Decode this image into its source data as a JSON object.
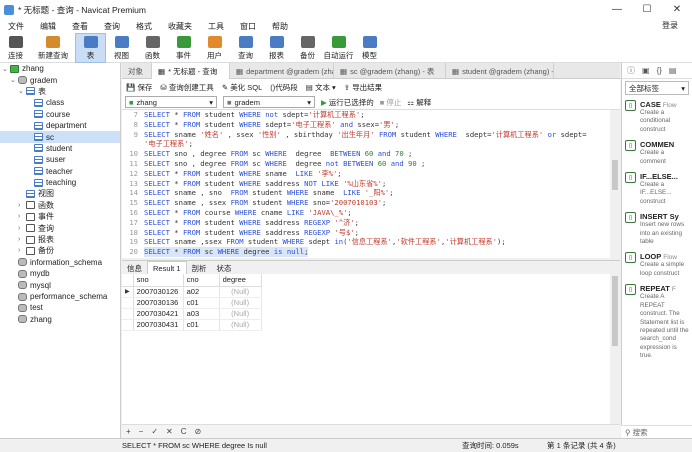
{
  "window": {
    "title": "* 无标题 - 查询 - Navicat Premium"
  },
  "menu": [
    "文件",
    "编辑",
    "查看",
    "查询",
    "格式",
    "收藏夹",
    "工具",
    "窗口",
    "帮助"
  ],
  "login_label": "登录",
  "toolbar": [
    {
      "label": "连接",
      "icon": "plug-icon",
      "color": "#555"
    },
    {
      "label": "新建查询",
      "icon": "new-query-icon",
      "color": "#d48b2c"
    },
    {
      "label": "表",
      "icon": "table-icon",
      "color": "#4a7cc4",
      "active": true
    },
    {
      "label": "视图",
      "icon": "view-icon",
      "color": "#4a7cc4"
    },
    {
      "label": "函数",
      "icon": "function-icon",
      "color": "#666"
    },
    {
      "label": "事件",
      "icon": "event-icon",
      "color": "#3a9a3a"
    },
    {
      "label": "用户",
      "icon": "user-icon",
      "color": "#e08a2c"
    },
    {
      "label": "查询",
      "icon": "query-icon",
      "color": "#4a7cc4"
    },
    {
      "label": "报表",
      "icon": "report-icon",
      "color": "#4a7cc4"
    },
    {
      "label": "备份",
      "icon": "backup-icon",
      "color": "#666"
    },
    {
      "label": "自动运行",
      "icon": "autorun-icon",
      "color": "#3a9a3a"
    },
    {
      "label": "模型",
      "icon": "model-icon",
      "color": "#4a7cc4"
    }
  ],
  "tree": [
    {
      "label": "zhang",
      "indent": 0,
      "type": "conn",
      "arrow": "v"
    },
    {
      "label": "gradem",
      "indent": 1,
      "type": "db",
      "arrow": "v"
    },
    {
      "label": "表",
      "indent": 2,
      "type": "tbl",
      "arrow": "v"
    },
    {
      "label": "class",
      "indent": 3,
      "type": "tbl",
      "arrow": ""
    },
    {
      "label": "course",
      "indent": 3,
      "type": "tbl",
      "arrow": ""
    },
    {
      "label": "department",
      "indent": 3,
      "type": "tbl",
      "arrow": ""
    },
    {
      "label": "sc",
      "indent": 3,
      "type": "tbl",
      "arrow": "",
      "selected": true
    },
    {
      "label": "student",
      "indent": 3,
      "type": "tbl",
      "arrow": ""
    },
    {
      "label": "suser",
      "indent": 3,
      "type": "tbl",
      "arrow": ""
    },
    {
      "label": "teacher",
      "indent": 3,
      "type": "tbl",
      "arrow": ""
    },
    {
      "label": "teaching",
      "indent": 3,
      "type": "tbl",
      "arrow": ""
    },
    {
      "label": "视图",
      "indent": 2,
      "type": "tbl",
      "arrow": ""
    },
    {
      "label": "函数",
      "indent": 2,
      "type": "fn",
      "arrow": ">"
    },
    {
      "label": "事件",
      "indent": 2,
      "type": "fn",
      "arrow": ">"
    },
    {
      "label": "查询",
      "indent": 2,
      "type": "fn",
      "arrow": ">"
    },
    {
      "label": "报表",
      "indent": 2,
      "type": "fn",
      "arrow": ">"
    },
    {
      "label": "备份",
      "indent": 2,
      "type": "fn",
      "arrow": ">"
    },
    {
      "label": "information_schema",
      "indent": 1,
      "type": "db",
      "arrow": ""
    },
    {
      "label": "mydb",
      "indent": 1,
      "type": "db",
      "arrow": ""
    },
    {
      "label": "mysql",
      "indent": 1,
      "type": "db",
      "arrow": ""
    },
    {
      "label": "performance_schema",
      "indent": 1,
      "type": "db",
      "arrow": ""
    },
    {
      "label": "test",
      "indent": 1,
      "type": "db",
      "arrow": ""
    },
    {
      "label": "zhang",
      "indent": 1,
      "type": "db",
      "arrow": ""
    }
  ],
  "tabs": [
    {
      "label": "对象",
      "active": false
    },
    {
      "label": "* 无标题 - 查询",
      "active": true
    },
    {
      "label": "department @gradem (zha...",
      "active": false
    },
    {
      "label": "sc @gradem (zhang) - 表",
      "active": false
    },
    {
      "label": "student @gradem (zhang) - ...",
      "active": false
    }
  ],
  "query_toolbar": {
    "save": "保存",
    "builder": "查询创建工具",
    "beautify": "美化 SQL",
    "snippet": "()代码段",
    "text": "文本",
    "export": "导出结果"
  },
  "query_toolbar2": {
    "connection": "zhang",
    "database": "gradem",
    "run": "运行已选择的",
    "stop": "停止",
    "explain": "解释"
  },
  "editor_lines": [
    {
      "no": "7",
      "code": "SELECT * FROM student WHERE not sdept='计算机工程系';"
    },
    {
      "no": "8",
      "code": "SELECT * FROM student WHERE sdept='电子工程系' and ssex='男';"
    },
    {
      "no": "9",
      "code": "SELECT sname '姓名' , ssex '性别' , sbirthday '出生年月' FROM student WHERE  sdept='计算机工程系' or sdept="
    },
    {
      "no": "",
      "code": "'电子工程系';"
    },
    {
      "no": "10",
      "code": "SELECT sno , degree FROM sc WHERE  degree  BETWEEN 60 and 70 ;"
    },
    {
      "no": "11",
      "code": "SELECT sno , degree FROM sc WHERE  degree not BETWEEN 60 and 90 ;"
    },
    {
      "no": "12",
      "code": "SELECT * FROM student WHERE sname  LIKE '李%';"
    },
    {
      "no": "13",
      "code": "SELECT * FROM student WHERE saddress NOT LIKE '%山东省%';"
    },
    {
      "no": "14",
      "code": "SELECT sname , sno  FROM student WHERE sname  LIKE '_阳%';"
    },
    {
      "no": "15",
      "code": "SELECT sname , ssex FROM student WHERE sno='2007010103';"
    },
    {
      "no": "16",
      "code": "SELECT * FROM course WHERE cname LIKE 'JAVA\\_%';"
    },
    {
      "no": "17",
      "code": "SELECT * FROM student WHERE saddress REGEXP '^济';"
    },
    {
      "no": "18",
      "code": "SELECT * FROM student WHERE saddress REGEXP '号$';"
    },
    {
      "no": "19",
      "code": "SELECT sname ,ssex FROM student WHERE sdept in('信息工程系','软件工程系','计算机工程系');"
    },
    {
      "no": "20",
      "code": "SELECT * FROM sc WHERE degree is null;",
      "highlight": true
    }
  ],
  "result_tabs": [
    {
      "label": "信息",
      "active": false
    },
    {
      "label": "Result 1",
      "active": true
    },
    {
      "label": "剖析",
      "active": false
    },
    {
      "label": "状态",
      "active": false
    }
  ],
  "grid": {
    "columns": [
      "sno",
      "cno",
      "degree"
    ],
    "rows": [
      [
        "2007030126",
        "a02",
        "(Null)"
      ],
      [
        "2007030136",
        "c01",
        "(Null)"
      ],
      [
        "2007030421",
        "a03",
        "(Null)"
      ],
      [
        "2007030431",
        "c01",
        "(Null)"
      ]
    ]
  },
  "grid_nav": [
    "+",
    "−",
    "✓",
    "✕",
    "C",
    "⊘"
  ],
  "status": {
    "sql": "SELECT * FROM sc WHERE degree Is null",
    "time": "查询时间: 0.059s",
    "records": "第 1 条记录 (共 4 条)"
  },
  "right_panel": {
    "filter": "全部标签",
    "search": "搜索",
    "snippets": [
      {
        "title": "CASE",
        "extra": "Flow",
        "desc": "Create a conditional construct"
      },
      {
        "title": "COMMEN",
        "extra": "",
        "desc": "Create a comment"
      },
      {
        "title": "IF...ELSE...",
        "extra": "",
        "desc": "Create a IF...ELSE... construct"
      },
      {
        "title": "INSERT Sy",
        "extra": "",
        "desc": "Insert new rows into an existing table"
      },
      {
        "title": "LOOP",
        "extra": "Flow",
        "desc": "Create a simple loop construct"
      },
      {
        "title": "REPEAT",
        "extra": "F",
        "desc": "Create A REPEAT construct. The Statement list is repeated until the search_cond expression is true."
      }
    ]
  }
}
